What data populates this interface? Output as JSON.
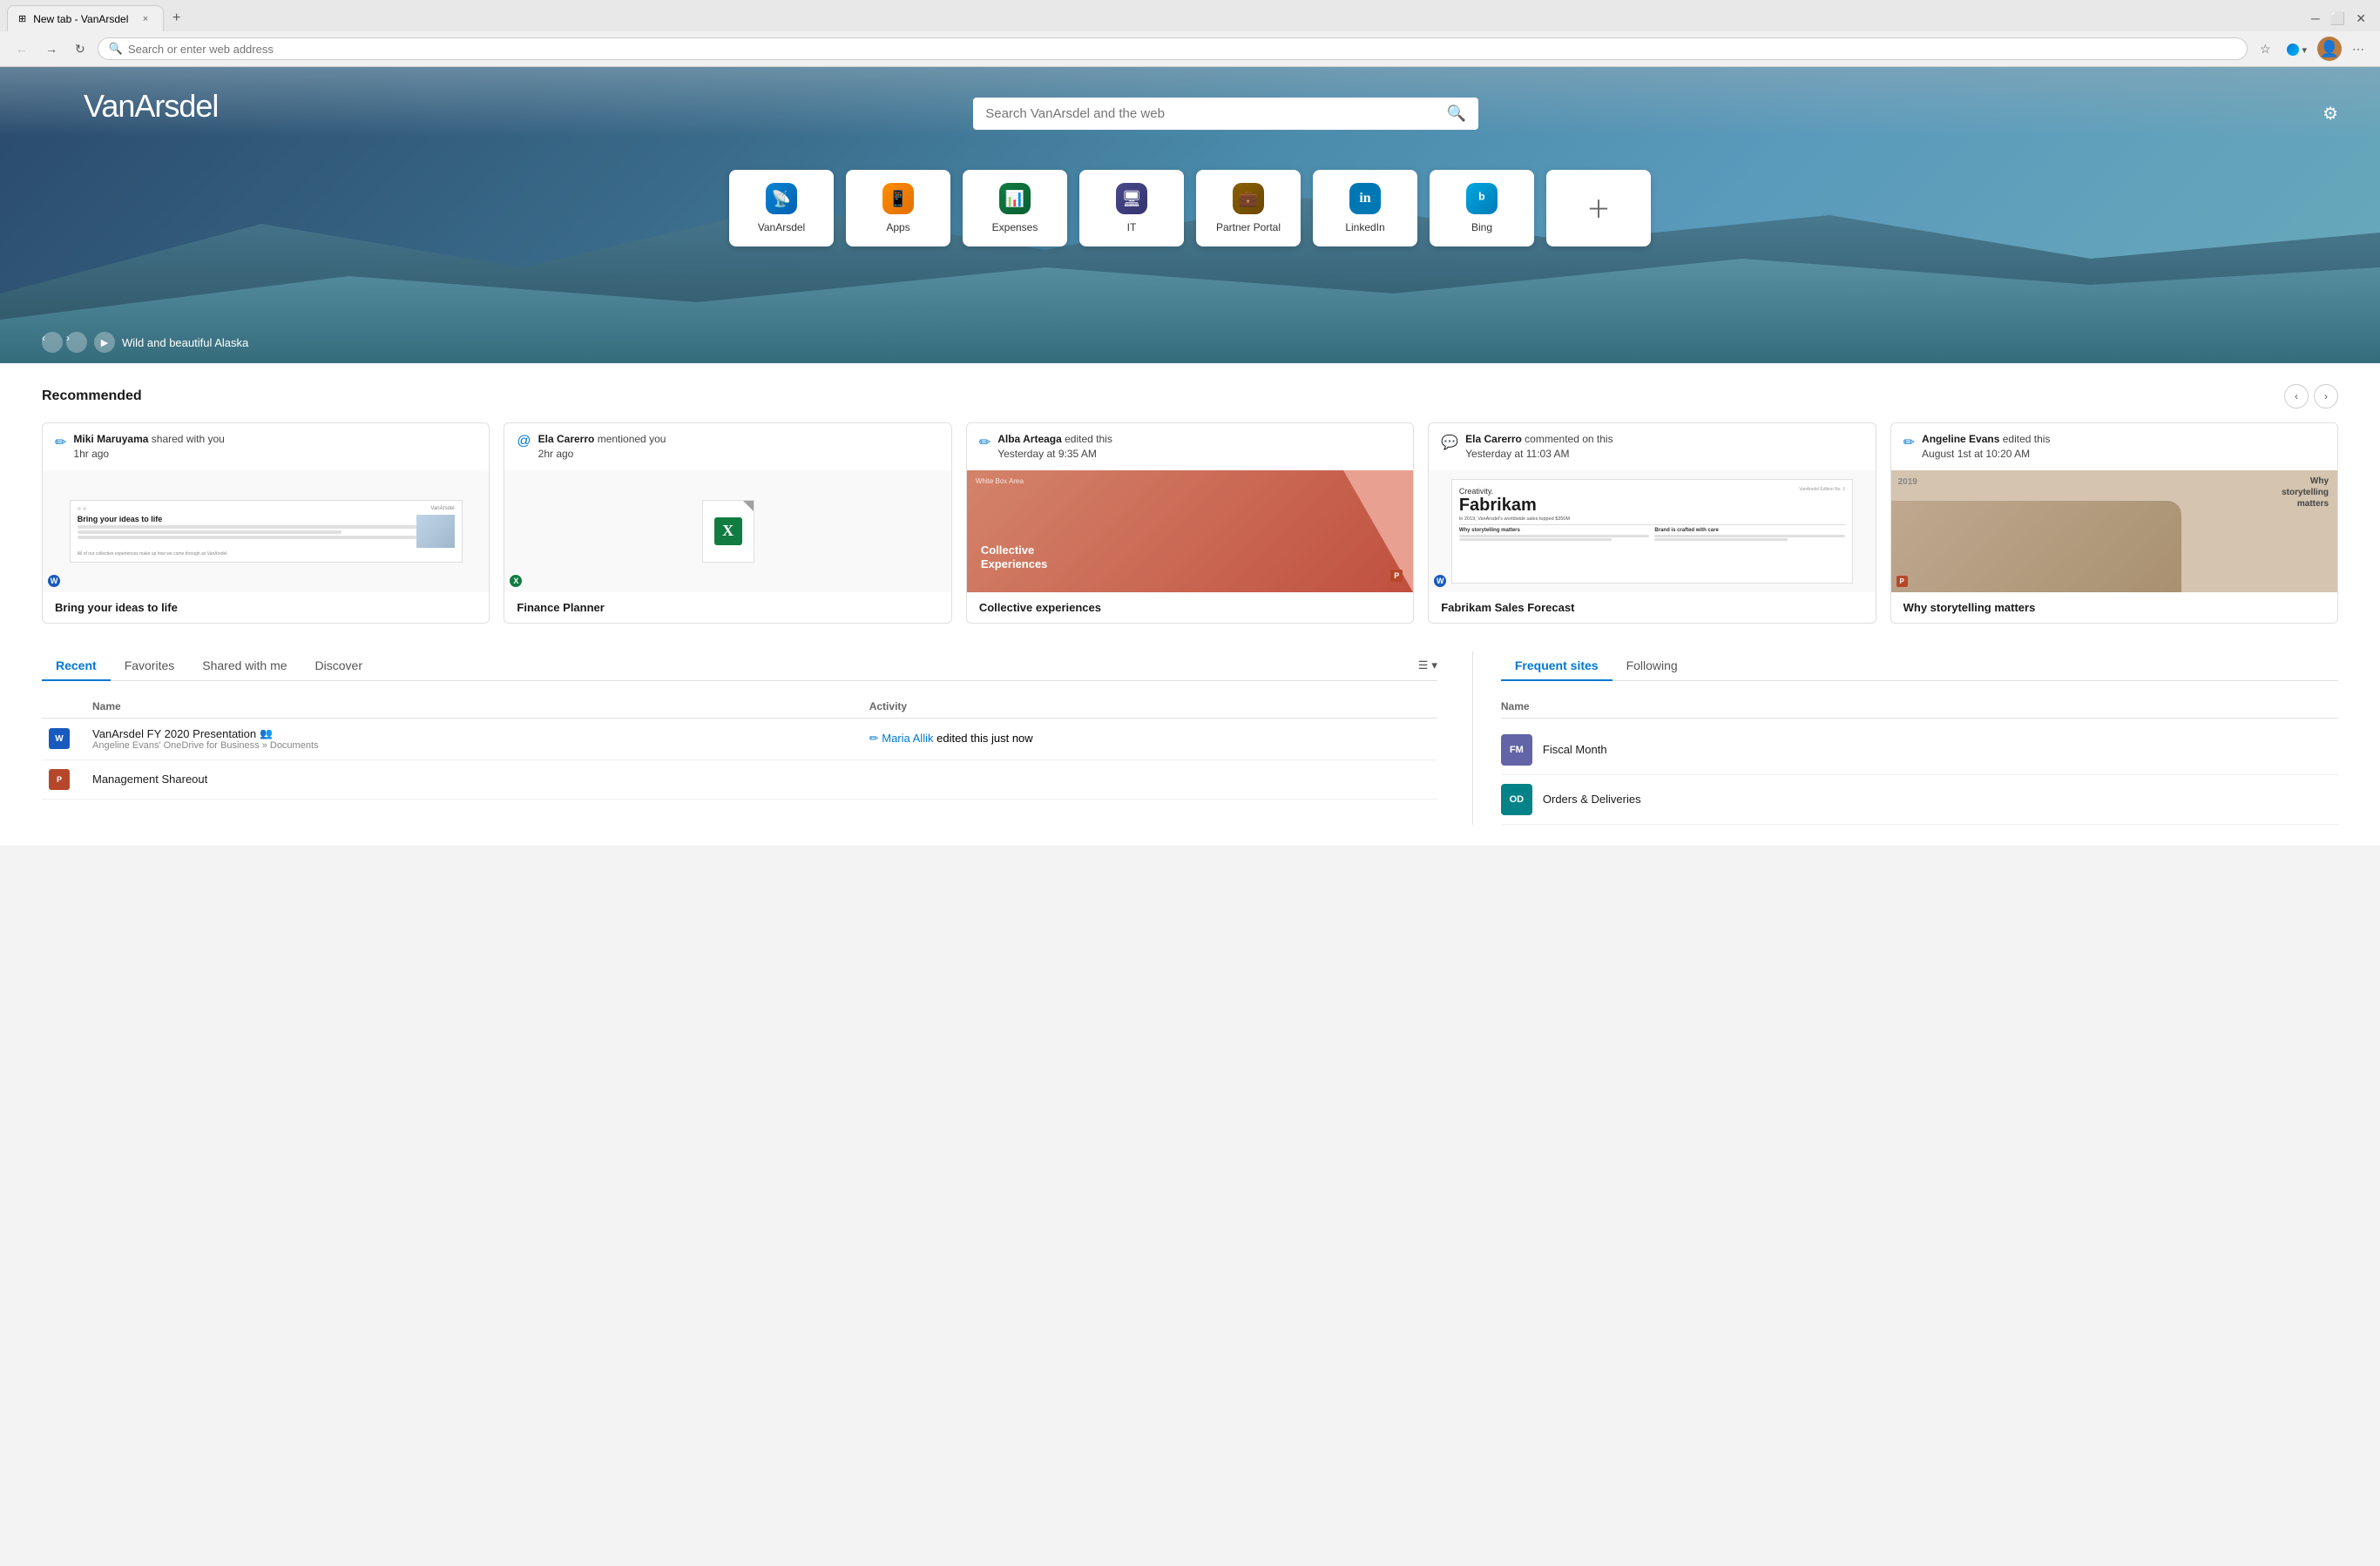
{
  "browser": {
    "tab_title": "New tab - VanArsdel",
    "new_tab_label": "+",
    "close_label": "×",
    "address_placeholder": "Search or enter web address",
    "address_value": ""
  },
  "hero": {
    "logo_text": "VanArsdel",
    "search_placeholder": "Search VanArsdel and the web",
    "bg_caption": "Wild and beautiful Alaska",
    "shortcuts": [
      {
        "id": "vanarsdel",
        "label": "VanArsdel",
        "icon_type": "vanarsdel"
      },
      {
        "id": "apps",
        "label": "Apps",
        "icon_type": "apps"
      },
      {
        "id": "expenses",
        "label": "Expenses",
        "icon_type": "expenses"
      },
      {
        "id": "it",
        "label": "IT",
        "icon_type": "it"
      },
      {
        "id": "partner",
        "label": "Partner Portal",
        "icon_type": "partner"
      },
      {
        "id": "linkedin",
        "label": "LinkedIn",
        "icon_type": "linkedin"
      },
      {
        "id": "bing",
        "label": "Bing",
        "icon_type": "bing"
      },
      {
        "id": "add",
        "label": "",
        "icon_type": "add"
      }
    ]
  },
  "recommended": {
    "title": "Recommended",
    "cards": [
      {
        "id": "bring-ideas",
        "user": "Miki Maruyama",
        "action": "shared with you",
        "time": "1hr ago",
        "icon_type": "pencil",
        "doc_type": "word",
        "title": "Bring your ideas to life",
        "preview_type": "word"
      },
      {
        "id": "finance-planner",
        "user": "Ela Carerro",
        "action": "mentioned you",
        "time": "2hr ago",
        "icon_type": "mention",
        "doc_type": "excel",
        "title": "Finance Planner",
        "preview_type": "excel"
      },
      {
        "id": "collective",
        "user": "Alba Arteaga",
        "action": "edited this",
        "time": "Yesterday at 9:35 AM",
        "icon_type": "pencil",
        "doc_type": "ppt",
        "title": "Collective experiences",
        "preview_type": "ppt-red"
      },
      {
        "id": "fabrikam",
        "user": "Ela Carerro",
        "action": "commented on this",
        "time": "Yesterday at 11:03 AM",
        "icon_type": "chat",
        "doc_type": "word",
        "title": "Fabrikam Sales Forecast",
        "preview_type": "fabrikam"
      },
      {
        "id": "storytelling",
        "user": "Angeline Evans",
        "action": "edited this",
        "time": "August 1st at 10:20 AM",
        "icon_type": "pencil",
        "doc_type": "ppt",
        "title": "Why storytelling matters",
        "preview_type": "storytelling"
      }
    ]
  },
  "files_section": {
    "tabs": [
      "Recent",
      "Favorites",
      "Shared with me",
      "Discover"
    ],
    "active_tab": "Recent",
    "columns": [
      "Name",
      "Activity"
    ],
    "files": [
      {
        "id": "vanarsdel-fy2020",
        "icon_type": "word",
        "name": "VanArsdel FY 2020 Presentation",
        "shared": true,
        "location": "Angeline Evans' OneDrive for Business » Documents",
        "activity_user": "Maria Allik",
        "activity_action": "edited this just now"
      },
      {
        "id": "management-shareout",
        "icon_type": "ppt",
        "name": "Management Shareout",
        "shared": false,
        "location": "",
        "activity_user": "",
        "activity_action": ""
      }
    ]
  },
  "frequent_sites": {
    "tabs": [
      "Frequent sites",
      "Following"
    ],
    "active_tab": "Frequent sites",
    "name_header": "Name",
    "sites": [
      {
        "id": "fiscal-month",
        "label": "FM",
        "name": "Fiscal Month",
        "color": "#6264a7"
      },
      {
        "id": "orders-deliveries",
        "label": "OD",
        "name": "Orders & Deliveries",
        "color": "#038387"
      }
    ]
  }
}
